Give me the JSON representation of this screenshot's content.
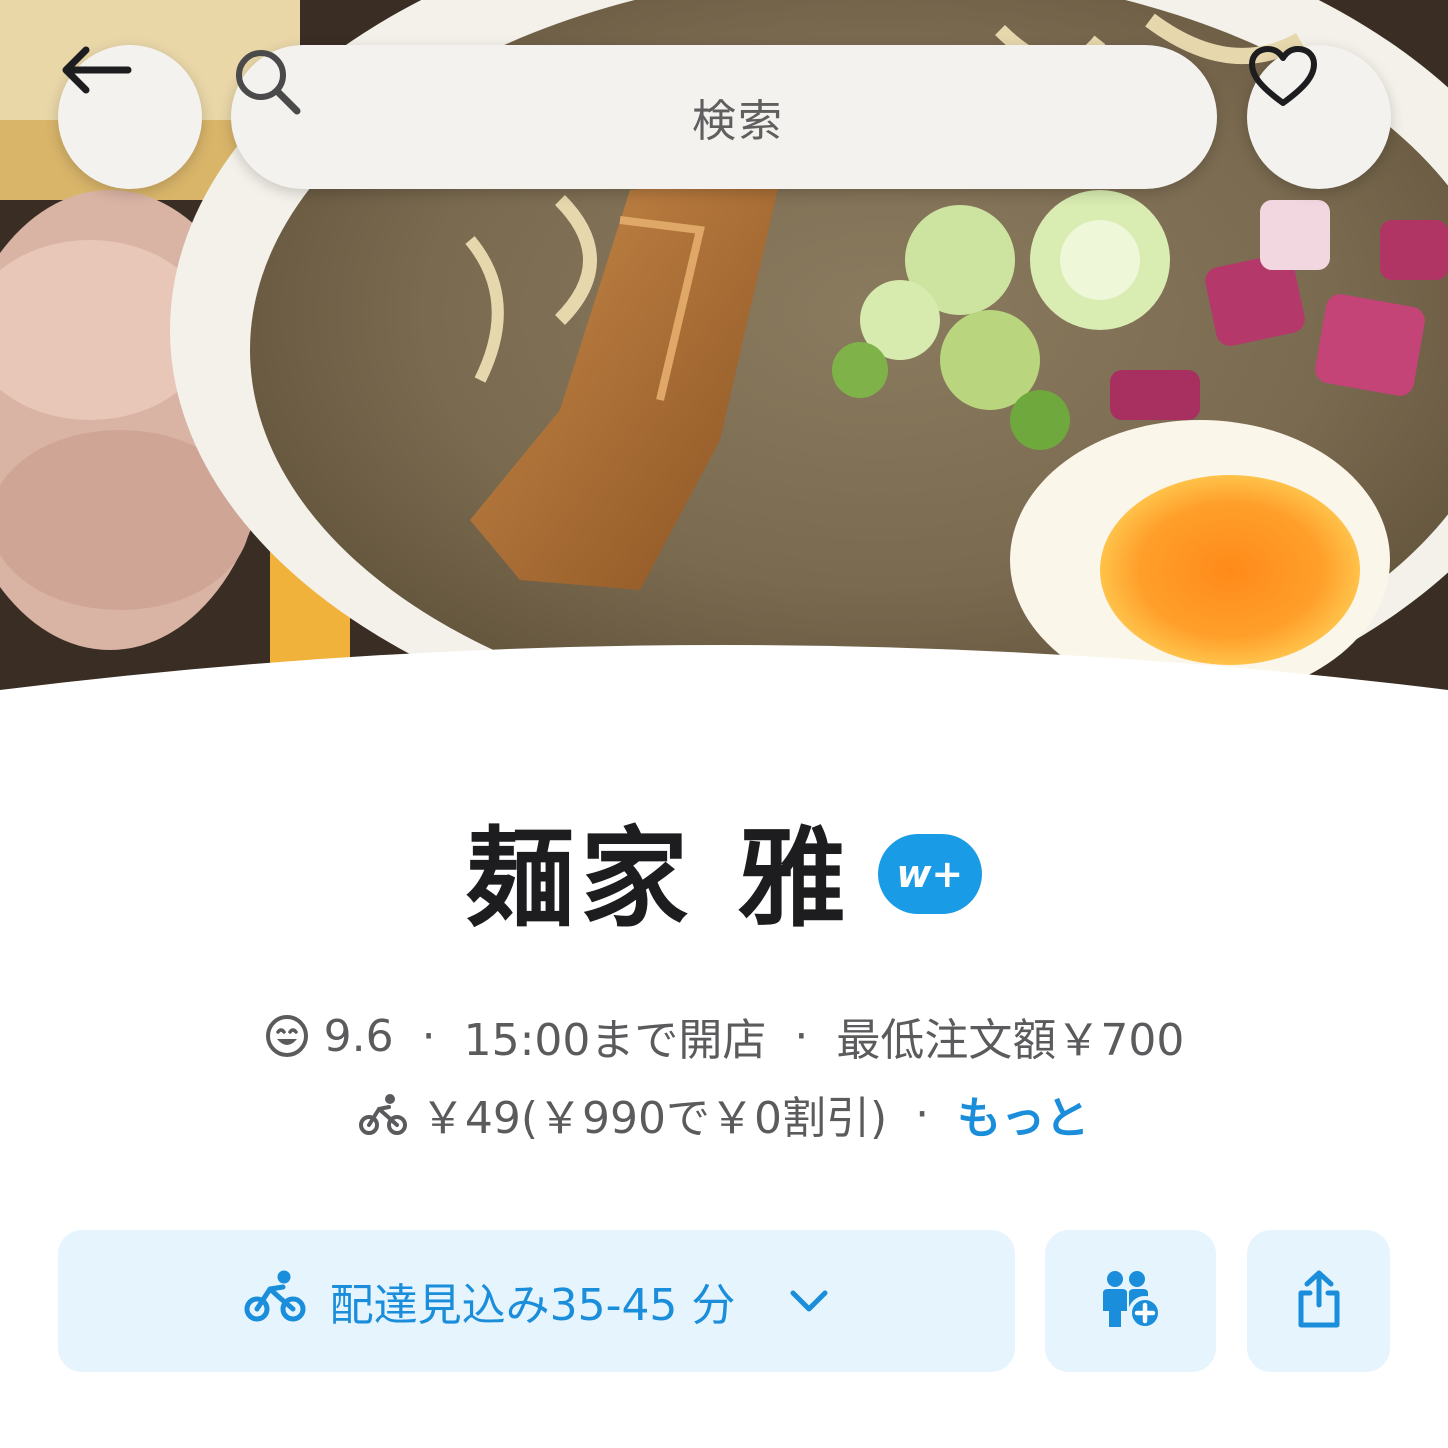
{
  "header": {
    "search": {
      "label": "検索",
      "icon": "search-icon"
    },
    "back_icon": "arrow-left-icon",
    "favorite_icon": "heart-icon"
  },
  "store": {
    "name": "麺家 雅",
    "badge": "w+",
    "rating": "9.6",
    "hours": "15:00まで開店",
    "min_order": "最低注文額￥700",
    "delivery_fee": "￥49(￥990で￥0割引)",
    "more_label": "もっと"
  },
  "actions": {
    "delivery_estimate": "配達見込み35-45 分",
    "group_order_icon": "group-add-icon",
    "share_icon": "share-icon"
  },
  "colors": {
    "accent": "#1a9be6",
    "button_bg": "#e6f4fd",
    "text_dark": "#1d1d1f",
    "text_muted": "#5b5b5e"
  }
}
